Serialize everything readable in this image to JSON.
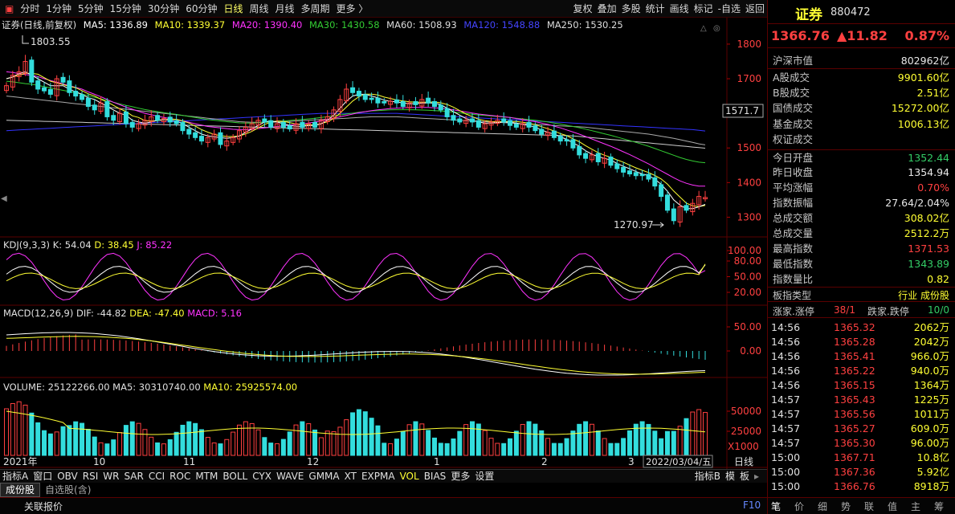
{
  "toolbar": {
    "periods": [
      "分时",
      "1分钟",
      "5分钟",
      "15分钟",
      "30分钟",
      "60分钟",
      "日线",
      "周线",
      "月线",
      "多周期",
      "更多 〉"
    ],
    "active_index": 6,
    "right_buttons": [
      "复权",
      "叠加",
      "多股",
      "统计",
      "画线",
      "标记",
      "-自选",
      "返回"
    ]
  },
  "info": {
    "name": "证券(日线,前复权)",
    "ma5": "MA5: 1336.89",
    "ma10": "MA10: 1339.37",
    "ma20": "MA20: 1390.40",
    "ma30": "MA30: 1430.58",
    "ma60": "MA60: 1508.93",
    "ma120": "MA120: 1548.88",
    "ma250": "MA250: 1530.25",
    "high_label": "1803.55",
    "low_label": "1270.97",
    "price_tag": "1571.7"
  },
  "colors": {
    "up": "#ff4040",
    "down": "#33dddd",
    "ma5": "#ffffff",
    "ma10": "#ffff33",
    "ma20": "#ff33ff",
    "ma30": "#33cc33",
    "ma60": "#aaaaaa",
    "ma120": "#3333ff",
    "ma250": "#cccccc",
    "dim_red": "#5a0000"
  },
  "price_axis": [
    "1800",
    "1700",
    "1600",
    "1500",
    "1400",
    "1300"
  ],
  "kdj": {
    "label": "KDJ(9,3,3)",
    "k": "K: 54.04",
    "d": "D: 38.45",
    "j": "J: 85.22",
    "axis": [
      "100.00",
      "80.00",
      "50.00",
      "20.00"
    ]
  },
  "macd": {
    "label": "MACD(12,26,9)",
    "dif": "DIF: -44.82",
    "dea": "DEA: -47.40",
    "macd": "MACD: 5.16",
    "axis": [
      "50.00",
      "0.00",
      "-50.00"
    ]
  },
  "volume": {
    "label": "VOLUME: 25122266.00",
    "ma5": "MA5: 30310740.00",
    "ma10": "MA10: 25925574.00",
    "axis": [
      "50000",
      "25000"
    ],
    "unit": "X1000"
  },
  "dates": {
    "items": [
      "2021年",
      "10",
      "11",
      "12",
      "1",
      "2",
      "3"
    ],
    "current": "2022/03/04/五",
    "period": "日线"
  },
  "chart_data": {
    "type": "candlestick",
    "ylim": [
      1250,
      1830
    ],
    "close": [
      1680,
      1710,
      1720,
      1750,
      1690,
      1670,
      1665,
      1655,
      1700,
      1690,
      1660,
      1650,
      1640,
      1620,
      1610,
      1630,
      1590,
      1580,
      1600,
      1570,
      1560,
      1570,
      1580,
      1590,
      1580,
      1585,
      1575,
      1570,
      1550,
      1540,
      1530,
      1520,
      1530,
      1540,
      1510,
      1520,
      1530,
      1550,
      1560,
      1570,
      1580,
      1575,
      1560,
      1570,
      1560,
      1555,
      1570,
      1560,
      1570,
      1560,
      1580,
      1590,
      1610,
      1640,
      1670,
      1660,
      1650,
      1640,
      1640,
      1630,
      1630,
      1635,
      1630,
      1620,
      1630,
      1625,
      1640,
      1630,
      1620,
      1610,
      1590,
      1580,
      1575,
      1580,
      1575,
      1560,
      1570,
      1575,
      1580,
      1575,
      1565,
      1560,
      1570,
      1560,
      1550,
      1540,
      1545,
      1530,
      1520,
      1520,
      1500,
      1480,
      1470,
      1480,
      1460,
      1470,
      1450,
      1440,
      1430,
      1425,
      1420,
      1420,
      1410,
      1390,
      1360,
      1320,
      1290,
      1330,
      1320,
      1340,
      1360,
      1357
    ],
    "up": [
      1,
      1,
      1,
      1,
      0,
      0,
      0,
      0,
      1,
      0,
      0,
      0,
      0,
      0,
      0,
      1,
      0,
      0,
      1,
      0,
      0,
      1,
      1,
      1,
      0,
      1,
      0,
      0,
      0,
      0,
      0,
      0,
      1,
      1,
      0,
      1,
      1,
      1,
      1,
      1,
      1,
      0,
      0,
      1,
      0,
      0,
      1,
      0,
      1,
      0,
      1,
      1,
      1,
      1,
      1,
      0,
      0,
      0,
      0,
      0,
      0,
      1,
      0,
      0,
      1,
      0,
      1,
      0,
      0,
      0,
      0,
      0,
      0,
      1,
      0,
      0,
      1,
      1,
      1,
      0,
      0,
      0,
      1,
      0,
      0,
      0,
      1,
      0,
      0,
      0,
      0,
      0,
      0,
      1,
      0,
      1,
      0,
      0,
      0,
      0,
      0,
      0,
      0,
      0,
      0,
      0,
      0,
      1,
      0,
      1,
      1,
      1
    ],
    "ma5": [
      1700,
      1705,
      1715,
      1720,
      1710,
      1700,
      1690,
      1680,
      1680,
      1680,
      1670,
      1662,
      1655,
      1645,
      1640,
      1630,
      1620,
      1610,
      1600,
      1595,
      1580,
      1575,
      1572,
      1575,
      1580,
      1582,
      1580,
      1578,
      1570,
      1560,
      1550,
      1540,
      1535,
      1532,
      1530,
      1528,
      1530,
      1535,
      1545,
      1555,
      1565,
      1575,
      1578,
      1575,
      1570,
      1565,
      1563,
      1562,
      1565,
      1565,
      1570,
      1580,
      1595,
      1615,
      1635,
      1650,
      1655,
      1655,
      1650,
      1645,
      1638,
      1635,
      1633,
      1630,
      1628,
      1628,
      1630,
      1630,
      1630,
      1625,
      1615,
      1605,
      1595,
      1585,
      1580,
      1575,
      1572,
      1572,
      1573,
      1575,
      1574,
      1572,
      1568,
      1565,
      1560,
      1552,
      1545,
      1540,
      1532,
      1525,
      1515,
      1505,
      1492,
      1482,
      1475,
      1470,
      1465,
      1455,
      1447,
      1440,
      1432,
      1425,
      1420,
      1410,
      1395,
      1375,
      1350,
      1335,
      1325,
      1325,
      1330,
      1337
    ],
    "ma20": [
      1720,
      1718,
      1715,
      1712,
      1710,
      1706,
      1700,
      1695,
      1690,
      1685,
      1680,
      1675,
      1670,
      1662,
      1655,
      1648,
      1640,
      1632,
      1625,
      1618,
      1612,
      1606,
      1600,
      1596,
      1592,
      1588,
      1585,
      1582,
      1578,
      1574,
      1570,
      1566,
      1562,
      1560,
      1558,
      1556,
      1554,
      1553,
      1553,
      1554,
      1556,
      1558,
      1560,
      1562,
      1564,
      1566,
      1568,
      1570,
      1572,
      1575,
      1578,
      1582,
      1586,
      1590,
      1594,
      1598,
      1602,
      1605,
      1608,
      1610,
      1612,
      1614,
      1615,
      1616,
      1617,
      1617,
      1617,
      1617,
      1616,
      1615,
      1613,
      1610,
      1607,
      1604,
      1601,
      1598,
      1596,
      1594,
      1592,
      1590,
      1588,
      1585,
      1582,
      1579,
      1576,
      1572,
      1568,
      1563,
      1558,
      1552,
      1546,
      1540,
      1533,
      1526,
      1519,
      1512,
      1505,
      1497,
      1489,
      1481,
      1472,
      1463,
      1454,
      1444,
      1434,
      1424,
      1414,
      1405,
      1398,
      1393,
      1390,
      1390
    ],
    "ma60": [
      1650,
      1648,
      1646,
      1644,
      1642,
      1640,
      1638,
      1636,
      1634,
      1632,
      1630,
      1628,
      1626,
      1624,
      1622,
      1620,
      1618,
      1616,
      1614,
      1612,
      1610,
      1608,
      1606,
      1604,
      1602,
      1600,
      1598,
      1596,
      1594,
      1592,
      1590,
      1588,
      1586,
      1584,
      1582,
      1580,
      1578,
      1576,
      1575,
      1574,
      1574,
      1574,
      1574,
      1575,
      1576,
      1577,
      1578,
      1579,
      1580,
      1581,
      1582,
      1583,
      1584,
      1585,
      1586,
      1587,
      1588,
      1589,
      1590,
      1590,
      1590,
      1590,
      1590,
      1589,
      1588,
      1587,
      1586,
      1585,
      1584,
      1583,
      1582,
      1581,
      1580,
      1579,
      1578,
      1577,
      1576,
      1575,
      1574,
      1573,
      1572,
      1571,
      1570,
      1569,
      1568,
      1567,
      1566,
      1565,
      1564,
      1563,
      1562,
      1561,
      1560,
      1558,
      1556,
      1554,
      1552,
      1550,
      1548,
      1546,
      1544,
      1542,
      1540,
      1537,
      1534,
      1531,
      1528,
      1524,
      1520,
      1516,
      1512,
      1509
    ],
    "ma120": [
      1550,
      1551,
      1552,
      1553,
      1554,
      1555,
      1556,
      1557,
      1558,
      1559,
      1560,
      1561,
      1562,
      1563,
      1564,
      1565,
      1566,
      1567,
      1568,
      1569,
      1570,
      1571,
      1572,
      1573,
      1574,
      1575,
      1576,
      1577,
      1578,
      1579,
      1580,
      1581,
      1582,
      1583,
      1584,
      1585,
      1586,
      1587,
      1588,
      1589,
      1590,
      1591,
      1592,
      1593,
      1594,
      1595,
      1596,
      1597,
      1598,
      1599,
      1600,
      1600,
      1600,
      1600,
      1600,
      1600,
      1600,
      1600,
      1600,
      1600,
      1600,
      1600,
      1600,
      1599,
      1598,
      1597,
      1596,
      1595,
      1594,
      1593,
      1592,
      1591,
      1590,
      1589,
      1588,
      1587,
      1586,
      1585,
      1584,
      1583,
      1582,
      1581,
      1580,
      1579,
      1578,
      1577,
      1576,
      1575,
      1574,
      1573,
      1572,
      1571,
      1570,
      1569,
      1568,
      1567,
      1566,
      1565,
      1564,
      1563,
      1562,
      1561,
      1560,
      1559,
      1558,
      1557,
      1556,
      1555,
      1554,
      1553,
      1551,
      1549
    ]
  },
  "right": {
    "title": "证券",
    "code": "880472",
    "price": "1366.76",
    "change": "▲11.82",
    "pct": "0.87%",
    "rows": [
      {
        "l": "沪深市值",
        "v": "802962亿",
        "c": "white"
      },
      {
        "l": "A股成交",
        "v": "9901.60亿",
        "c": "yel"
      },
      {
        "l": "B股成交",
        "v": "2.51亿",
        "c": "yel"
      },
      {
        "l": "国债成交",
        "v": "15272.00亿",
        "c": "yel"
      },
      {
        "l": "基金成交",
        "v": "1006.13亿",
        "c": "yel"
      },
      {
        "l": "权证成交",
        "v": "",
        "c": "yel"
      },
      {
        "l": "今日开盘",
        "v": "1352.44",
        "c": "green"
      },
      {
        "l": "昨日收盘",
        "v": "1354.94",
        "c": "white"
      },
      {
        "l": "平均涨幅",
        "v": "0.70%",
        "c": "red"
      },
      {
        "l": "指数振幅",
        "v": "27.64/2.04%",
        "c": "white"
      },
      {
        "l": "总成交额",
        "v": "308.02亿",
        "c": "yel"
      },
      {
        "l": "总成交量",
        "v": "2512.2万",
        "c": "yel"
      },
      {
        "l": "最高指数",
        "v": "1371.53",
        "c": "red"
      },
      {
        "l": "最低指数",
        "v": "1343.89",
        "c": "green"
      },
      {
        "l": "指数量比",
        "v": "0.82",
        "c": "yel"
      }
    ],
    "board_type": "板指类型",
    "board_val": "行业 成份股",
    "updown_l": "涨家.涨停",
    "updown_v": "38/1",
    "down_l": "跌家.跌停",
    "down_v": "10/0",
    "ticks": [
      [
        "14:56",
        "1365.32",
        "2062万"
      ],
      [
        "14:56",
        "1365.28",
        "2042万"
      ],
      [
        "14:56",
        "1365.41",
        "966.0万"
      ],
      [
        "14:56",
        "1365.22",
        "940.0万"
      ],
      [
        "14:56",
        "1365.15",
        "1364万"
      ],
      [
        "14:57",
        "1365.43",
        "1225万"
      ],
      [
        "14:57",
        "1365.56",
        "1011万"
      ],
      [
        "14:57",
        "1365.27",
        "609.0万"
      ],
      [
        "14:57",
        "1365.30",
        "96.00万"
      ],
      [
        "15:00",
        "1367.71",
        "10.8亿"
      ],
      [
        "15:00",
        "1367.36",
        "5.92亿"
      ],
      [
        "15:00",
        "1366.76",
        "8918万"
      ]
    ],
    "bottom_tabs": [
      "笔",
      "价",
      "细",
      "势",
      "联",
      "值",
      "主",
      "筹"
    ]
  },
  "indicators": [
    "指标A",
    "窗口",
    "OBV",
    "RSI",
    "WR",
    "SAR",
    "CCI",
    "ROC",
    "MTM",
    "BOLL",
    "CYX",
    "WAVE",
    "GMMA",
    "XT",
    "EXPMA",
    "VOL",
    "BIAS",
    "更多",
    "设置"
  ],
  "indicator_active": "VOL",
  "indicator_right": [
    "指标B",
    "模",
    "板"
  ],
  "tabs": [
    "成份股",
    "自选股(含)"
  ],
  "status": {
    "quote": "关联报价",
    "key": "F10"
  }
}
